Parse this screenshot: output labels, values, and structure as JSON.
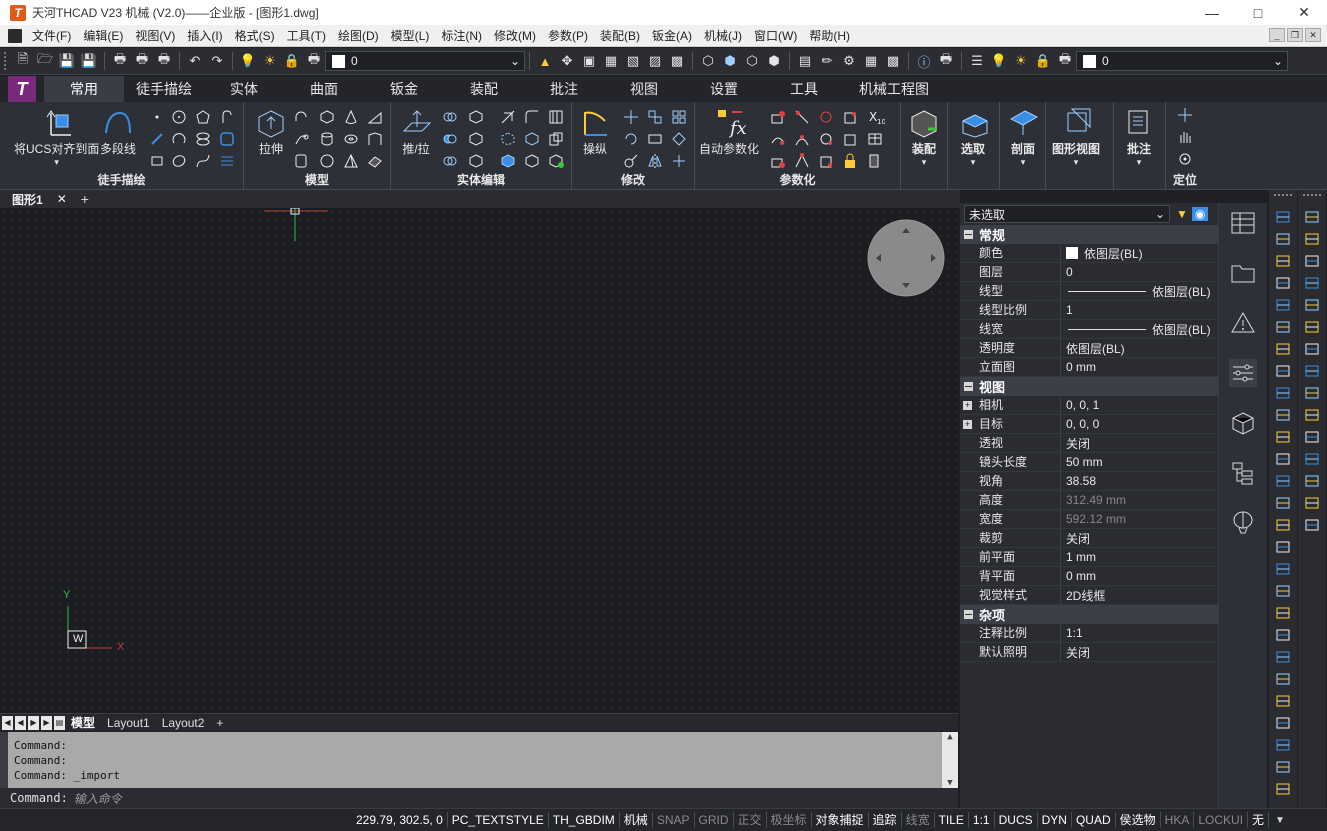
{
  "window": {
    "title": "天河THCAD V23 机械 (V2.0)——企业版 - [图形1.dwg]",
    "logo": "T",
    "controls": [
      "minimize",
      "maximize",
      "close"
    ]
  },
  "menubar": {
    "items": [
      "文件(F)",
      "编辑(E)",
      "视图(V)",
      "插入(I)",
      "格式(S)",
      "工具(T)",
      "绘图(D)",
      "模型(L)",
      "标注(N)",
      "修改(M)",
      "参数(P)",
      "装配(B)",
      "钣金(A)",
      "机械(J)",
      "窗口(W)",
      "帮助(H)"
    ]
  },
  "toolbar": {
    "layer_value": "0",
    "layer_value_2": "0"
  },
  "ribbon": {
    "logo": "T",
    "tabs": [
      "常用",
      "徒手描绘",
      "实体",
      "曲面",
      "钣金",
      "装配",
      "批注",
      "视图",
      "设置",
      "工具",
      "机械工程图"
    ],
    "active_tab": "常用",
    "panels": {
      "freehand": {
        "title": "徒手描绘",
        "big1": "将UCS对齐到面",
        "big2": "多段线"
      },
      "model": {
        "title": "模型",
        "big1": "拉伸"
      },
      "solid_edit": {
        "title": "实体编辑",
        "big1": "推/拉"
      },
      "modify": {
        "title": "修改",
        "big1": "操纵"
      },
      "param": {
        "title": "参数化",
        "big1": "自动参数化"
      },
      "assembly": {
        "big1": "装配"
      },
      "select": {
        "big1": "选取"
      },
      "section": {
        "big1": "剖面"
      },
      "graphview": {
        "big1": "图形视图"
      },
      "annot": {
        "big1": "批注"
      },
      "locate": {
        "big1": "定位"
      }
    }
  },
  "doc_tabs": {
    "active": "图形1",
    "close": "✕",
    "add": "+"
  },
  "canvas": {
    "ucs_y": "Y",
    "ucs_x": "X",
    "ucs_w": "W"
  },
  "layout_tabs": {
    "tabs": [
      "模型",
      "Layout1",
      "Layout2"
    ],
    "add": "+"
  },
  "command": {
    "lines": [
      "Command:",
      "Command:",
      "Command: _import"
    ],
    "prompt": "Command:",
    "placeholder": "输入命令"
  },
  "statusbar": {
    "coords": "229.79, 302.5, 0",
    "cells": [
      {
        "label": "PC_TEXTSTYLE",
        "on": true
      },
      {
        "label": "TH_GBDIM",
        "on": true
      },
      {
        "label": "机械",
        "on": true
      },
      {
        "label": "SNAP",
        "on": false
      },
      {
        "label": "GRID",
        "on": false
      },
      {
        "label": "正交",
        "on": false
      },
      {
        "label": "极坐标",
        "on": false
      },
      {
        "label": "对象捕捉",
        "on": true
      },
      {
        "label": "追踪",
        "on": true
      },
      {
        "label": "线宽",
        "on": false
      },
      {
        "label": "TILE",
        "on": true
      },
      {
        "label": "1:1",
        "on": true
      },
      {
        "label": "DUCS",
        "on": true
      },
      {
        "label": "DYN",
        "on": true
      },
      {
        "label": "QUAD",
        "on": true
      },
      {
        "label": "侯选物",
        "on": true
      },
      {
        "label": "HKA",
        "on": false
      },
      {
        "label": "LOCKUI",
        "on": false
      },
      {
        "label": "无",
        "on": true
      }
    ]
  },
  "properties": {
    "selection": "未选取",
    "sections": [
      {
        "title": "常规",
        "rows": [
          {
            "key": "颜色",
            "value": "依图层(BL)",
            "swatch": true
          },
          {
            "key": "图层",
            "value": "0"
          },
          {
            "key": "线型",
            "value": "依图层(BL)",
            "line": true
          },
          {
            "key": "线型比例",
            "value": "1"
          },
          {
            "key": "线宽",
            "value": "依图层(BL)",
            "line": true
          },
          {
            "key": "透明度",
            "value": "依图层(BL)"
          },
          {
            "key": "立面图",
            "value": "0 mm"
          }
        ]
      },
      {
        "title": "视图",
        "rows": [
          {
            "key": "相机",
            "value": "0, 0, 1",
            "expand": true
          },
          {
            "key": "目标",
            "value": "0, 0, 0",
            "expand": true
          },
          {
            "key": "透视",
            "value": "关闭"
          },
          {
            "key": "镜头长度",
            "value": "50 mm"
          },
          {
            "key": "视角",
            "value": "38.58"
          },
          {
            "key": "高度",
            "value": "312.49 mm",
            "dim": true
          },
          {
            "key": "宽度",
            "value": "592.12 mm",
            "dim": true
          },
          {
            "key": "裁剪",
            "value": "关闭"
          },
          {
            "key": "前平面",
            "value": "1 mm"
          },
          {
            "key": "背平面",
            "value": "0 mm"
          },
          {
            "key": "视觉样式",
            "value": "2D线框"
          }
        ]
      },
      {
        "title": "杂项",
        "rows": [
          {
            "key": "注释比例",
            "value": "1:1"
          },
          {
            "key": "默认照明",
            "value": "关闭"
          }
        ]
      }
    ]
  },
  "sidebar_icons": [
    "properties-grid-icon",
    "folder-icon",
    "warning-icon",
    "sliders-icon",
    "cube-icon",
    "tree-icon",
    "balloon-icon"
  ],
  "colors": {
    "accent_blue": "#3a8ee6",
    "brand_orange": "#e05a1a",
    "ribbon_logo": "#7a2a7a"
  }
}
